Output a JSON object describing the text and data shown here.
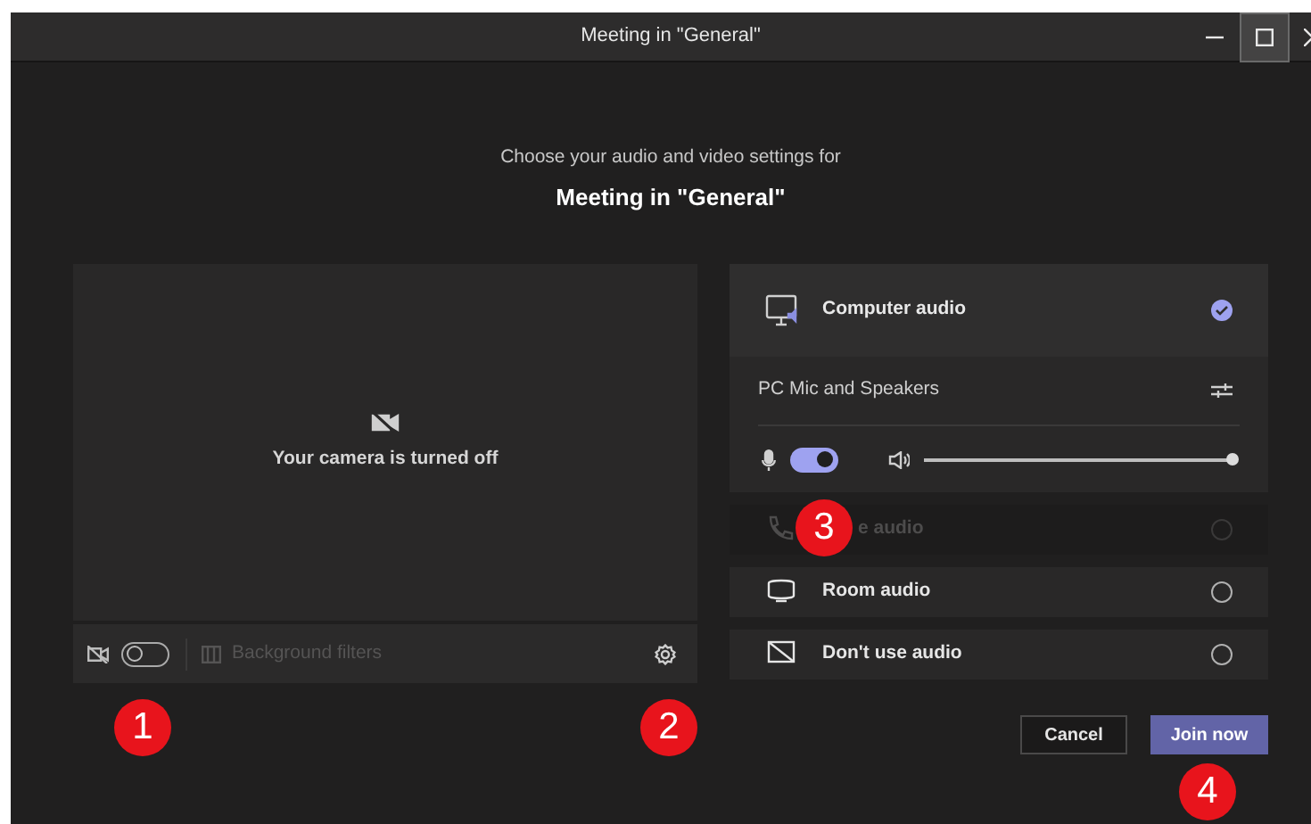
{
  "window": {
    "title": "Meeting in \"General\""
  },
  "prompt": "Choose your audio and video settings for",
  "meeting_title": "Meeting in \"General\"",
  "video": {
    "status": "Your camera is turned off",
    "camera_on": false,
    "background_filters": {
      "label": "Background filters",
      "disabled": true
    }
  },
  "audio_options": [
    {
      "kind": "computer",
      "label": "Computer audio",
      "selected": true,
      "disabled": false
    },
    {
      "kind": "phone",
      "label": "e audio",
      "selected": false,
      "disabled": true
    },
    {
      "kind": "room",
      "label": "Room audio",
      "selected": false,
      "disabled": false
    },
    {
      "kind": "none",
      "label": "Don't use audio",
      "selected": false,
      "disabled": false
    }
  ],
  "device": {
    "label": "PC Mic and Speakers",
    "mic_on": true,
    "speaker": {
      "level": 1.0
    }
  },
  "buttons": [
    {
      "kind": "secondary",
      "label": "Cancel"
    },
    {
      "kind": "primary",
      "label": "Join now"
    }
  ],
  "callouts": [
    {
      "label": "1"
    },
    {
      "label": "2"
    },
    {
      "label": "3"
    },
    {
      "label": "4"
    }
  ]
}
